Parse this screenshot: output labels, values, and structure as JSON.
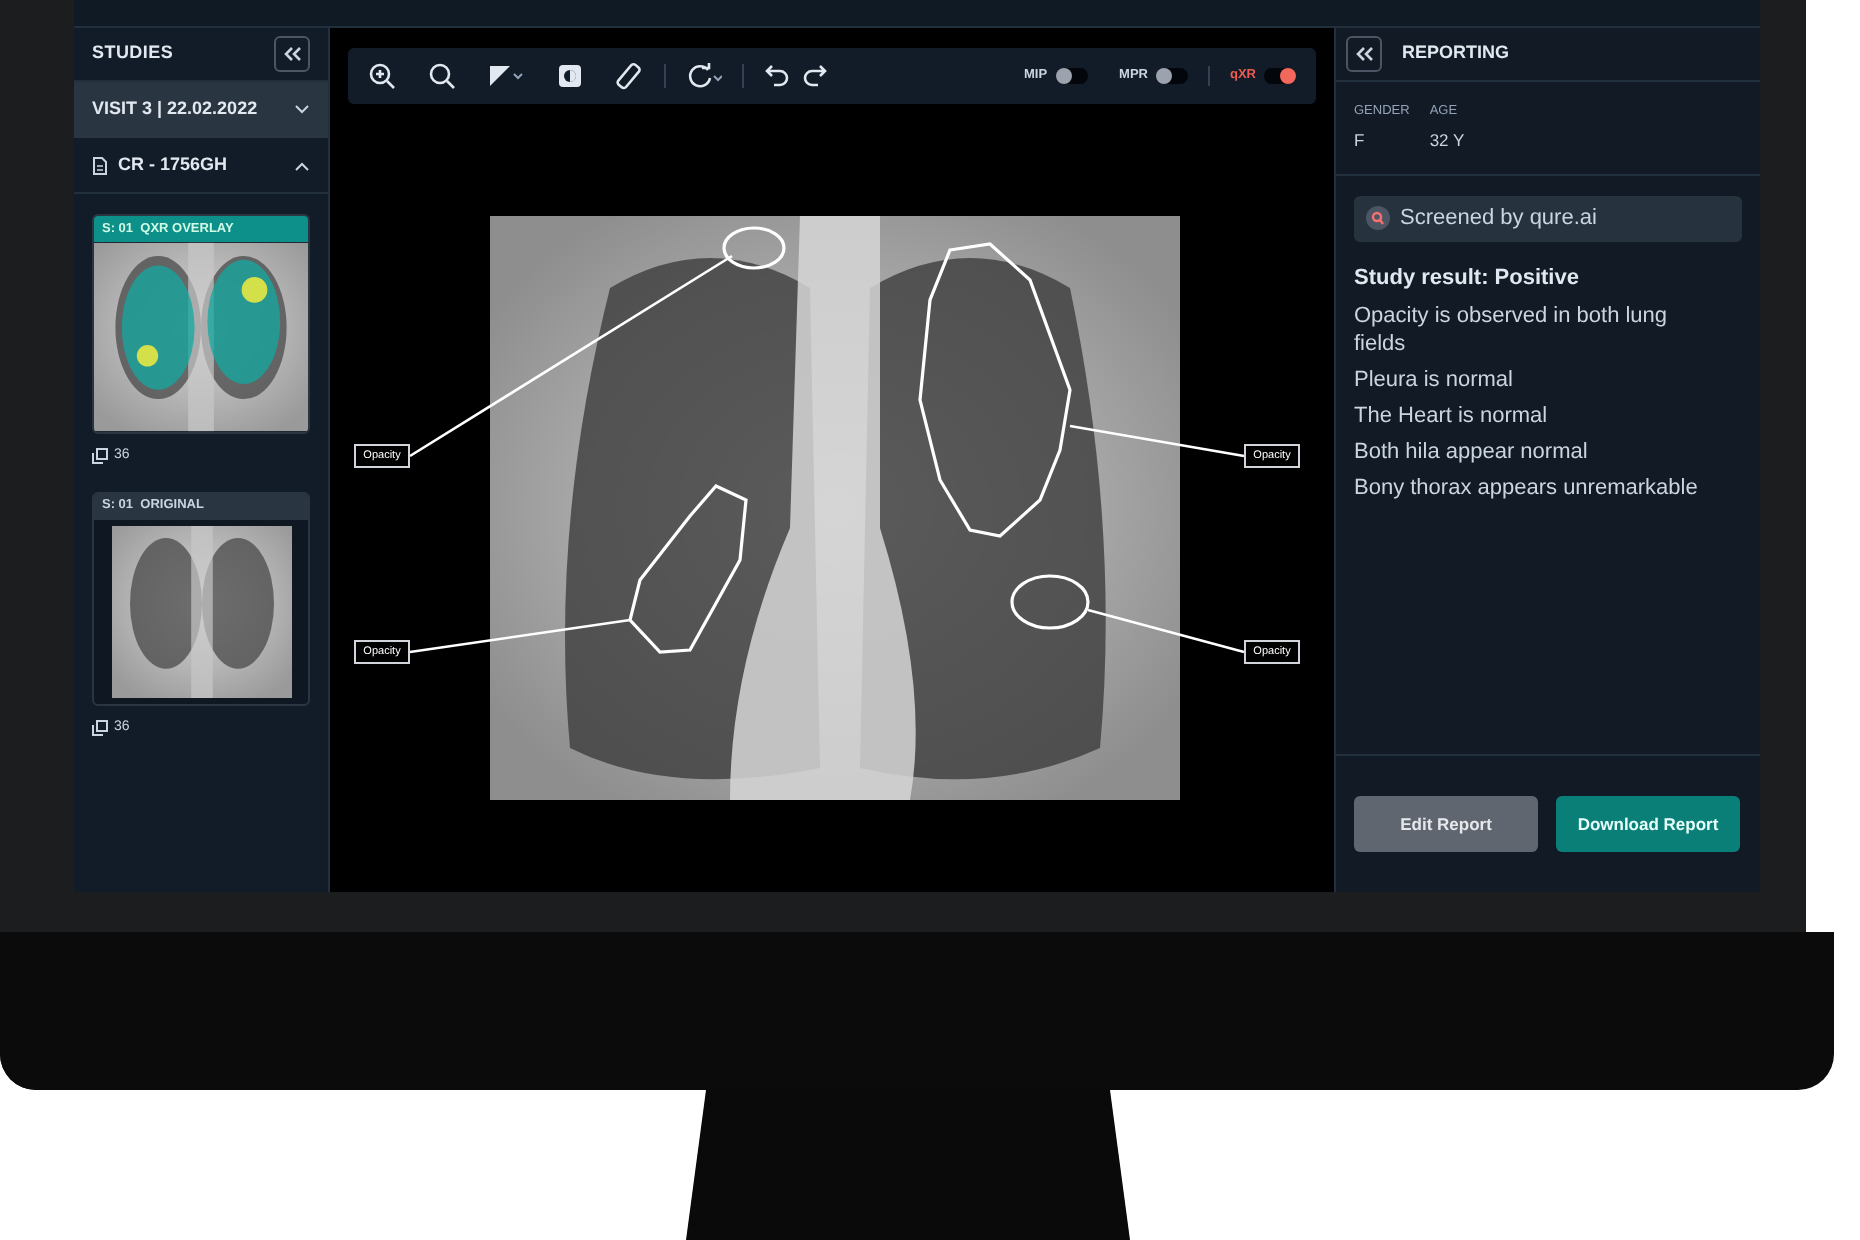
{
  "sidebar": {
    "title": "STUDIES",
    "visit": "VISIT 3 | 22.02.2022",
    "study": "CR - 1756GH",
    "series": [
      {
        "kind": "overlay",
        "label": "S: 01  QXR OVERLAY",
        "count": "36"
      },
      {
        "kind": "original",
        "label": "S: 01  ORIGINAL",
        "count": "36"
      }
    ]
  },
  "toolbar": {
    "toggles": [
      {
        "label": "MIP",
        "on": false
      },
      {
        "label": "MPR",
        "on": false
      },
      {
        "label": "qXR",
        "on": true
      }
    ]
  },
  "viewer": {
    "annotations": [
      {
        "label": "Opacity"
      },
      {
        "label": "Opacity"
      },
      {
        "label": "Opacity"
      },
      {
        "label": "Opacity"
      }
    ]
  },
  "reporting": {
    "title": "REPORTING",
    "fields": [
      {
        "label": "GENDER",
        "value": "F"
      },
      {
        "label": "AGE",
        "value": "32 Y"
      }
    ],
    "screened_by": "Screened by qure.ai",
    "result": "Study result: Positive",
    "findings": [
      "Opacity is observed in both lung fields",
      "Pleura is normal",
      "The Heart is normal",
      "Both hila appear normal",
      "Bony thorax appears unremarkable"
    ],
    "buttons": [
      {
        "label": "Edit Report",
        "kind": "secondary"
      },
      {
        "label": "Download Report",
        "kind": "primary"
      }
    ]
  }
}
